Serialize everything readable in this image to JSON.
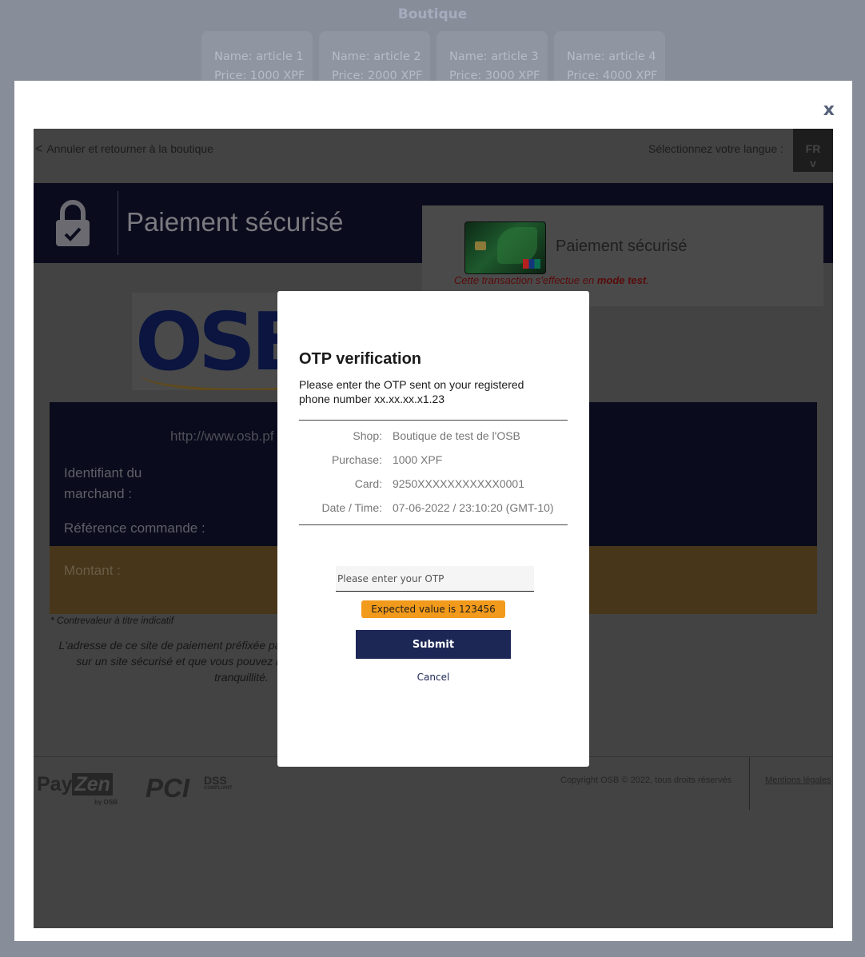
{
  "shop": {
    "title": "Boutique",
    "articles": [
      {
        "name": "Name: article 1",
        "price": "Price: 1000 XPF"
      },
      {
        "name": "Name: article 2",
        "price": "Price: 2000 XPF"
      },
      {
        "name": "Name: article 3",
        "price": "Price: 3000 XPF"
      },
      {
        "name": "Name: article 4",
        "price": "Price: 4000 XPF"
      }
    ]
  },
  "modal": {
    "close_label": "x"
  },
  "payment_page": {
    "back_link": "Annuler et retourner à la boutique",
    "back_icon": "<",
    "language_label": "Sélectionnez votre langue :",
    "language_value": "FR",
    "language_chevron": "v",
    "banner_title": "Paiement sécurisé",
    "card_title": "Paiement sécurisé",
    "test_note_prefix": "Cette transaction s'effectue en ",
    "test_note_bold": "mode test",
    "test_note_suffix": ".",
    "logo_text": "OSB",
    "merchant_url": "http://www.osb.pf",
    "merchant_id_label": "Identifiant du marchand :",
    "order_ref_label": "Référence commande :",
    "amount_label": "Montant :",
    "contre_valeur": "* Contrevaleur à titre indicatif",
    "secure_note": "L'adresse de ce site de paiement préfixée par https indique que vous êtes sur un site sécurisé et que vous pouvez régler votre achat en toute tranquillité.",
    "footer": {
      "payzen_pay": "Pay",
      "payzen_zen": "Zen",
      "payzen_by": "by OSB",
      "pci": "PCI",
      "dss": "DSS",
      "dss_sub": "COMPLIANT",
      "copyright": "Copyright OSB © 2022, tous droits réservés",
      "mentions": "Mentions légales"
    }
  },
  "otp": {
    "title": "OTP verification",
    "description": "Please enter the OTP sent on your registered phone number xx.xx.xx.x1.23",
    "rows": [
      {
        "label": "Shop:",
        "value": "Boutique de test de l'OSB"
      },
      {
        "label": "Purchase:",
        "value": "1000 XPF"
      },
      {
        "label": "Card:",
        "value": "9250XXXXXXXXXXX0001"
      },
      {
        "label": "Date / Time:",
        "value": "07-06-2022 / 23:10:20 (GMT-10)"
      }
    ],
    "input_placeholder": "Please enter your OTP",
    "input_value": "",
    "expected_hint": "Expected value is 123456",
    "submit_label": "Submit",
    "cancel_label": "Cancel"
  },
  "colors": {
    "submit_bg": "#1c2756",
    "hint_bg": "#f29a1b",
    "overlay": "#888d9a"
  }
}
